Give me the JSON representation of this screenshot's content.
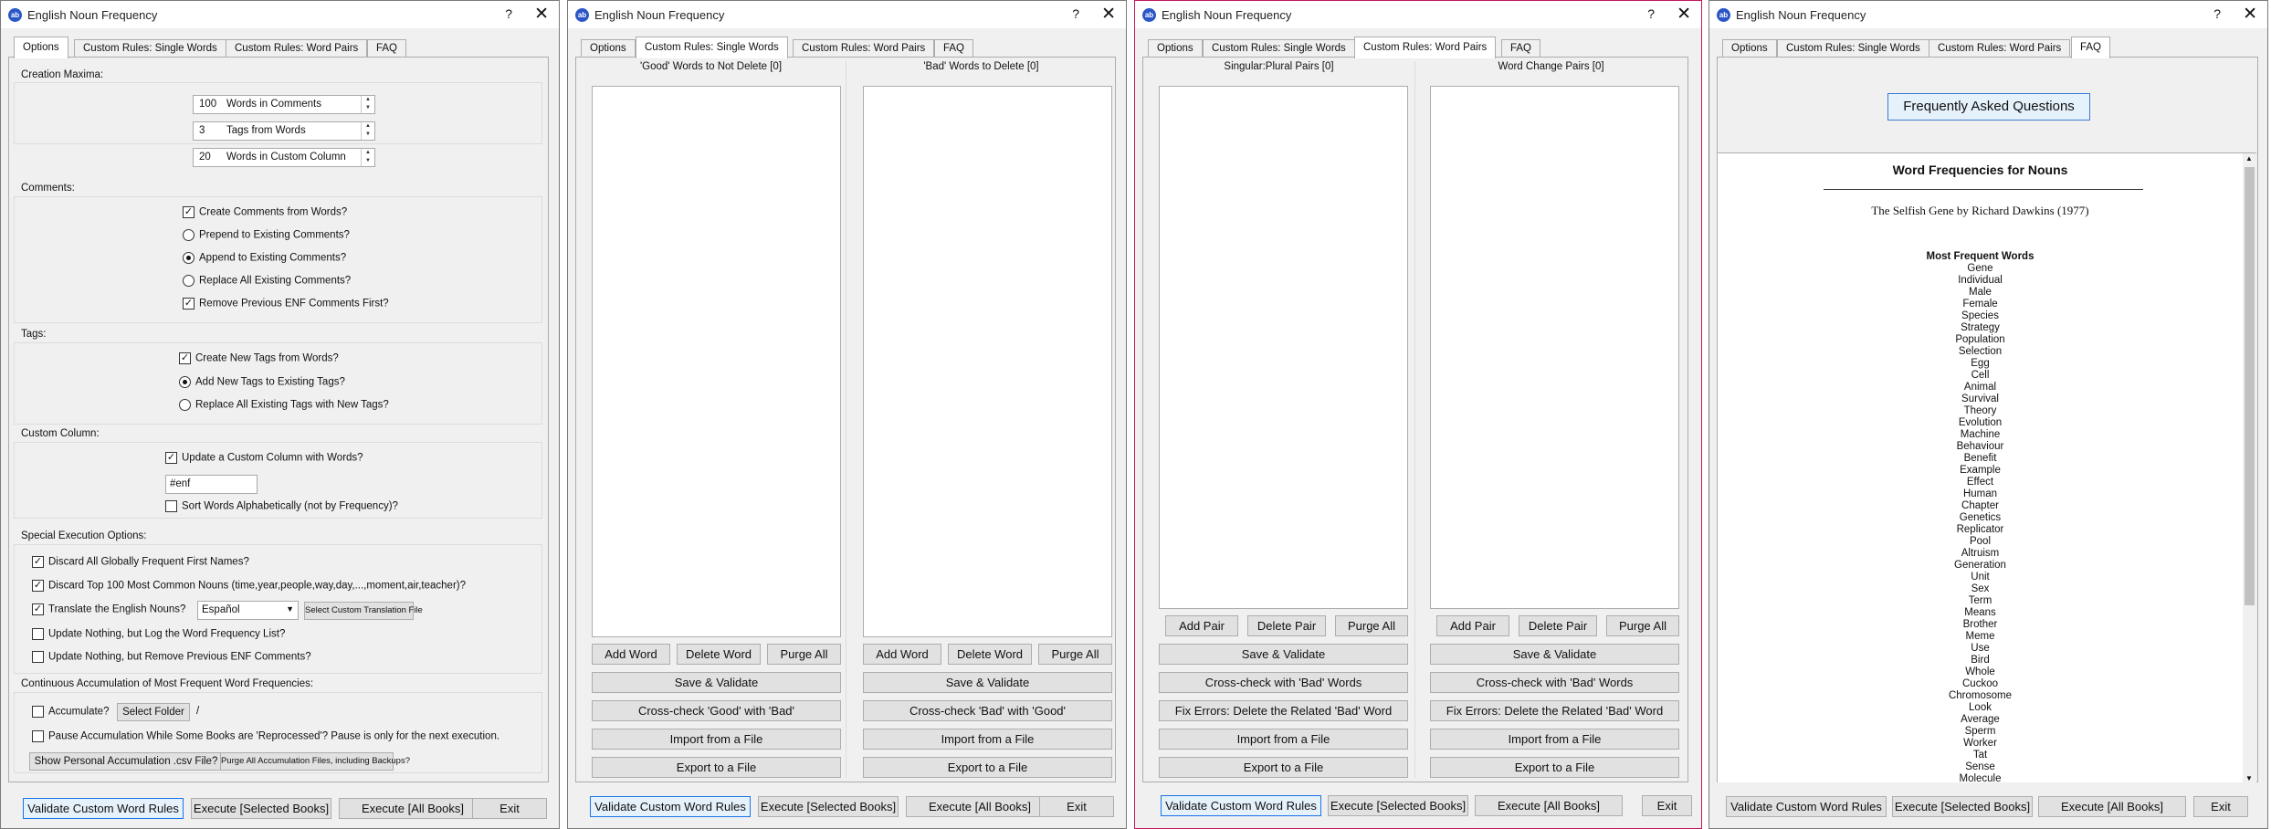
{
  "app_title": "English Noun Frequency",
  "titlebar": {
    "help": "?",
    "close": "✕",
    "icon": "ab"
  },
  "tabs": [
    "Options",
    "Custom Rules: Single Words",
    "Custom Rules: Word Pairs",
    "FAQ"
  ],
  "bottom_buttons": {
    "validate": "Validate Custom Word Rules",
    "exec_selected": "Execute  [Selected Books]",
    "exec_all": "Execute [All Books]",
    "exit": "Exit"
  },
  "options": {
    "creation_maxima": {
      "label": "Creation Maxima:",
      "spinners": [
        {
          "value": "100",
          "label": "Words in Comments"
        },
        {
          "value": "3",
          "label": "Tags from Words"
        },
        {
          "value": "20",
          "label": "Words in Custom Column"
        }
      ]
    },
    "comments": {
      "label": "Comments:",
      "items": [
        {
          "text": "Create Comments from Words?",
          "kind": "check",
          "on": true
        },
        {
          "text": "Prepend to Existing Comments?",
          "kind": "radio",
          "on": false
        },
        {
          "text": "Append to Existing Comments?",
          "kind": "radio",
          "on": true
        },
        {
          "text": "Replace All Existing Comments?",
          "kind": "radio",
          "on": false
        },
        {
          "text": "Remove Previous ENF Comments First?",
          "kind": "check",
          "on": true
        }
      ]
    },
    "tags": {
      "label": "Tags:",
      "items": [
        {
          "text": "Create New Tags from Words?",
          "kind": "check",
          "on": true
        },
        {
          "text": "Add New Tags to Existing Tags?",
          "kind": "radio",
          "on": true
        },
        {
          "text": "Replace All Existing Tags with New Tags?",
          "kind": "radio",
          "on": false
        }
      ]
    },
    "custom_column": {
      "label": "Custom Column:",
      "update": {
        "text": "Update a Custom Column with Words?",
        "on": true
      },
      "column_name": "#enf",
      "sort": {
        "text": "Sort Words Alphabetically (not by Frequency)?",
        "on": false
      }
    },
    "special": {
      "label": "Special Execution Options:",
      "discard_names": {
        "text": "Discard All Globally Frequent First Names?",
        "on": true
      },
      "discard_top100": {
        "text": "Discard Top 100 Most Common Nouns (time,year,people,way,day,...,moment,air,teacher)?",
        "on": true
      },
      "translate": {
        "text": "Translate the English Nouns?",
        "on": true
      },
      "language": "Español",
      "translation_file_btn": "Select Custom Translation File",
      "log_only": {
        "text": "Update Nothing, but Log the Word Frequency List?",
        "on": false
      },
      "remove_only": {
        "text": "Update Nothing, but Remove Previous ENF Comments?",
        "on": false
      }
    },
    "accumulation": {
      "label": "Continuous Accumulation of Most Frequent Word Frequencies:",
      "accumulate": {
        "text": "Accumulate?",
        "on": false
      },
      "select_folder": "Select Folder",
      "folder_path": "/",
      "pause": {
        "text": "Pause Accumulation While Some Books are 'Reprocessed'?   Pause is only for the next execution.",
        "on": false
      },
      "show_csv": "Show Personal Accumulation .csv File?",
      "purge_files": "Purge All Accumulation Files, including Backups?"
    }
  },
  "single_words": {
    "left_title": "'Good' Words to Not Delete [0]",
    "right_title": "'Bad' Words to Delete [0]",
    "add": "Add Word",
    "delete": "Delete Word",
    "purge": "Purge All",
    "save": "Save & Validate",
    "cross_left": "Cross-check 'Good' with 'Bad'",
    "cross_right": "Cross-check 'Bad' with 'Good'",
    "import": "Import from a File",
    "export": "Export to a File"
  },
  "word_pairs": {
    "left_title": "Singular:Plural Pairs [0]",
    "right_title": "Word Change Pairs [0]",
    "add": "Add Pair",
    "delete": "Delete Pair",
    "purge": "Purge All",
    "save": "Save & Validate",
    "cross": "Cross-check with 'Bad' Words",
    "fix": "Fix Errors: Delete the Related 'Bad' Word",
    "import": "Import from a File",
    "export": "Export to a File"
  },
  "faq": {
    "button": "Frequently Asked Questions",
    "heading": "Word Frequencies for Nouns",
    "book": "The Selfish Gene by Richard Dawkins (1977)",
    "list_heading": "Most Frequent Words",
    "words": [
      "Gene",
      "Individual",
      "Male",
      "Female",
      "Species",
      "Strategy",
      "Population",
      "Selection",
      "Egg",
      "Cell",
      "Animal",
      "Survival",
      "Theory",
      "Evolution",
      "Machine",
      "Behaviour",
      "Benefit",
      "Example",
      "Effect",
      "Human",
      "Chapter",
      "Genetics",
      "Replicator",
      "Pool",
      "Altruism",
      "Generation",
      "Unit",
      "Sex",
      "Term",
      "Means",
      "Brother",
      "Meme",
      "Use",
      "Bird",
      "Whole",
      "Cuckoo",
      "Chromosome",
      "Look",
      "Average",
      "Sperm",
      "Worker",
      "Tat",
      "Sense",
      "Molecule"
    ]
  }
}
